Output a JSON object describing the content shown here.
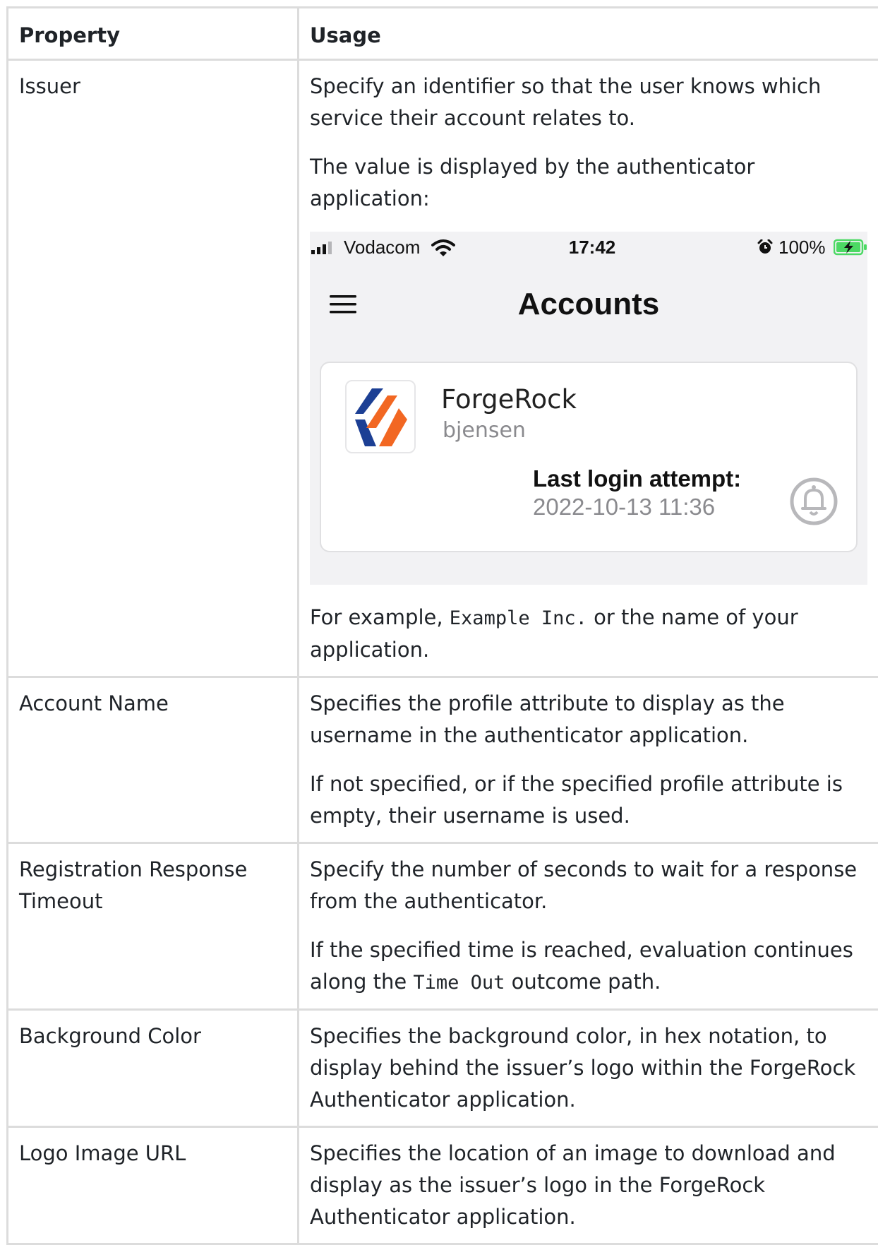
{
  "table": {
    "headers": {
      "property": "Property",
      "usage": "Usage"
    },
    "rows": [
      {
        "property": "Issuer",
        "usage": {
          "p1": "Specify an identifier so that the user knows which service their account relates to.",
          "p2": "The value is displayed by the authenticator application:",
          "p3_pre": "For example, ",
          "p3_code": "Example Inc.",
          "p3_post": " or the name of your application."
        }
      },
      {
        "property": "Account Name",
        "usage": {
          "p1": "Specifies the profile attribute to display as the username in the authenticator application.",
          "p2": "If not specified, or if the specified profile attribute is empty, their username is used."
        }
      },
      {
        "property": "Registration Response Timeout",
        "usage": {
          "p1": "Specify the number of seconds to wait for a response from the authenticator.",
          "p2_pre": "If the specified time is reached, evaluation continues along the ",
          "p2_code": "Time Out",
          "p2_post": " outcome path."
        }
      },
      {
        "property": "Background Color",
        "usage": {
          "p1": "Specifies the background color, in hex notation, to display behind the issuer’s logo within the ForgeRock Authenticator application."
        }
      },
      {
        "property": "Logo Image URL",
        "usage": {
          "p1": "Specifies the location of an image to download and display as the issuer’s logo in the ForgeRock Authenticator application."
        }
      }
    ]
  },
  "phone": {
    "carrier": "Vodacom",
    "time": "17:42",
    "battery": "100%",
    "title": "Accounts",
    "account": {
      "issuer": "ForgeRock",
      "user": "bjensen",
      "last_login_label": "Last login attempt:",
      "last_login_value": "2022-10-13 11:36"
    },
    "icons": [
      "signal-icon",
      "wifi-icon",
      "alarm-icon",
      "battery-charging-icon",
      "menu-icon",
      "forgerock-logo-icon",
      "bell-icon"
    ],
    "colors": {
      "logo_blue": "#1c3f94",
      "logo_orange": "#f26722",
      "battery_green": "#4cd964"
    }
  }
}
